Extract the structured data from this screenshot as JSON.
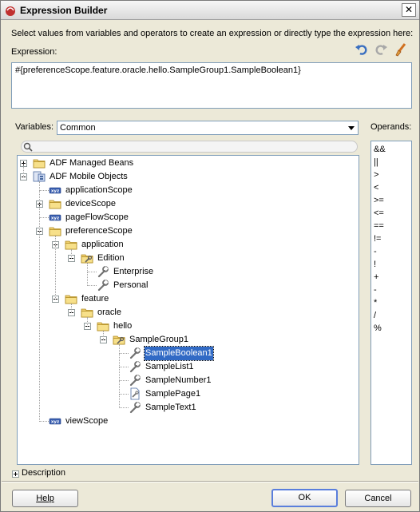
{
  "window": {
    "title": "Expression Builder",
    "close_glyph": "✕"
  },
  "instructions": "Select values from variables and operators to create an expression or directly type the expression here:",
  "expression": {
    "label": "Expression:",
    "value": "#{preferenceScope.feature.oracle.hello.SampleGroup1.SampleBoolean1}"
  },
  "toolbar": {
    "icons": [
      "undo-icon",
      "redo-icon",
      "clear-icon"
    ]
  },
  "variables": {
    "label": "Variables:",
    "selected": "Common"
  },
  "operands": {
    "label": "Operands:",
    "items": [
      "&&",
      "||",
      ">",
      "<",
      ">=",
      "<=",
      "==",
      "!=",
      "-",
      "!",
      "+",
      "-",
      "*",
      "/",
      "%"
    ]
  },
  "tree": {
    "items": [
      {
        "label": "ADF Managed Beans",
        "icon": "folder-icon"
      },
      {
        "label": "ADF Mobile Objects",
        "icon": "objects-icon"
      },
      {
        "label": "applicationScope",
        "icon": "scope-icon"
      },
      {
        "label": "deviceScope",
        "icon": "folder-icon"
      },
      {
        "label": "pageFlowScope",
        "icon": "scope-icon"
      },
      {
        "label": "preferenceScope",
        "icon": "folder-icon"
      },
      {
        "label": "application",
        "icon": "folder-icon"
      },
      {
        "label": "Edition",
        "icon": "group-folder-icon"
      },
      {
        "label": "Enterprise",
        "icon": "wrench-icon"
      },
      {
        "label": "Personal",
        "icon": "wrench-icon"
      },
      {
        "label": "feature",
        "icon": "folder-icon"
      },
      {
        "label": "oracle",
        "icon": "folder-icon"
      },
      {
        "label": "hello",
        "icon": "folder-icon"
      },
      {
        "label": "SampleGroup1",
        "icon": "group-folder-icon"
      },
      {
        "label": "SampleBoolean1",
        "icon": "wrench-icon",
        "selected": true
      },
      {
        "label": "SampleList1",
        "icon": "wrench-icon"
      },
      {
        "label": "SampleNumber1",
        "icon": "wrench-icon"
      },
      {
        "label": "SamplePage1",
        "icon": "page-icon"
      },
      {
        "label": "SampleText1",
        "icon": "wrench-icon"
      },
      {
        "label": "viewScope",
        "icon": "scope-icon"
      }
    ]
  },
  "description": {
    "label": "Description"
  },
  "buttons": {
    "help": "Help",
    "ok": "OK",
    "cancel": "Cancel"
  },
  "colors": {
    "selection": "#316ac5",
    "dialog_bg": "#ece9d8",
    "folder": "#f0d070"
  }
}
